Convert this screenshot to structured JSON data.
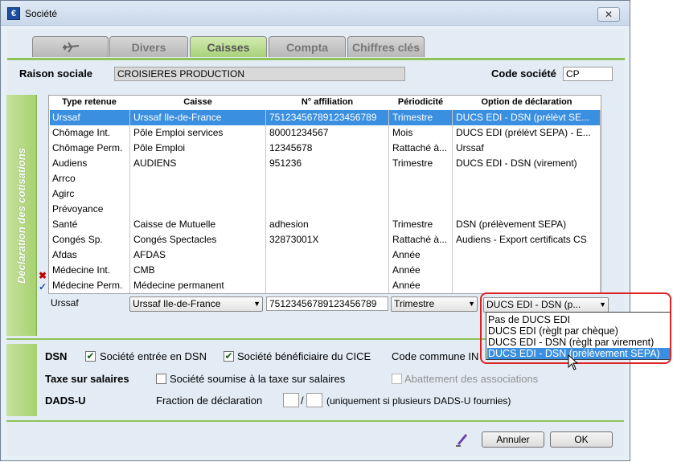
{
  "window": {
    "title": "Société",
    "close": "✕"
  },
  "tabs": [
    {
      "label": ""
    },
    {
      "label": "Divers"
    },
    {
      "label": "Caisses"
    },
    {
      "label": "Compta"
    },
    {
      "label": "Chiffres clés"
    }
  ],
  "header": {
    "raison_label": "Raison sociale",
    "raison_value": "CROISIERES PRODUCTION",
    "code_label": "Code société",
    "code_value": "CP"
  },
  "side_label": "Déclaration des cotisations",
  "grid": {
    "columns": [
      "Type retenue",
      "Caisse",
      "N° affiliation",
      "Périodicité",
      "Option de déclaration"
    ],
    "rows": [
      [
        "Urssaf",
        "Urssaf Ile-de-France",
        "75123456789123456789",
        "Trimestre",
        "DUCS EDI - DSN (prélèvt SE..."
      ],
      [
        "Chômage Int.",
        "Pôle Emploi services",
        "80001234567",
        "Mois",
        "DUCS EDI (prélèvt SEPA) - E..."
      ],
      [
        "Chômage Perm.",
        "Pôle Emploi",
        "12345678",
        "Rattaché à...",
        "Urssaf"
      ],
      [
        "Audiens",
        "AUDIENS",
        "951236",
        "Trimestre",
        "DUCS EDI - DSN (virement)"
      ],
      [
        "Arrco",
        "",
        "",
        "",
        ""
      ],
      [
        "Agirc",
        "",
        "",
        "",
        ""
      ],
      [
        "Prévoyance",
        "",
        "",
        "",
        ""
      ],
      [
        "Santé",
        "Caisse de Mutuelle",
        "adhesion",
        "Trimestre",
        "DSN (prélèvement SEPA)"
      ],
      [
        "Congés Sp.",
        "Congés Spectacles",
        "32873001X",
        "Rattaché à...",
        "Audiens - Export certificats CS"
      ],
      [
        "Afdas",
        "AFDAS",
        "",
        "Année",
        ""
      ],
      [
        "Médecine Int.",
        "CMB",
        "",
        "Année",
        ""
      ],
      [
        "Médecine Perm.",
        "Médecine permanent",
        "",
        "Année",
        ""
      ]
    ]
  },
  "edit": {
    "type": "Urssaf",
    "caisse": "Urssaf Ile-de-France",
    "affiliation": "75123456789123456789",
    "periodicite": "Trimestre",
    "option": "DUCS EDI - DSN (p..."
  },
  "dropdown": {
    "options": [
      "Pas de DUCS EDI",
      "DUCS EDI (règlt par chèque)",
      "DUCS EDI - DSN (règlt par virement)",
      "DUCS EDI - DSN (prélèvement SEPA)"
    ],
    "selected_index": 3
  },
  "dsn": {
    "label": "DSN",
    "entree": "Société entrée en DSN",
    "cice": "Société bénéficiaire du CICE",
    "code_commune": "Code commune IN"
  },
  "taxe": {
    "label": "Taxe sur salaires",
    "soumise": "Société soumise à la taxe sur salaires",
    "abattement": "Abattement des associations"
  },
  "dadsu": {
    "label": "DADS-U",
    "fraction_label": "Fraction de déclaration",
    "slash": "/",
    "note": "(uniquement si plusieurs DADS-U fournies)"
  },
  "buttons": {
    "cancel": "Annuler",
    "ok": "OK"
  },
  "marks": {
    "delete": "✖",
    "down": "✓"
  },
  "colors": {
    "tab_active": "#a9d27a",
    "selection": "#3a8fe0",
    "accent_green": "#8fc35a",
    "highlight_ring": "#dd2222"
  }
}
